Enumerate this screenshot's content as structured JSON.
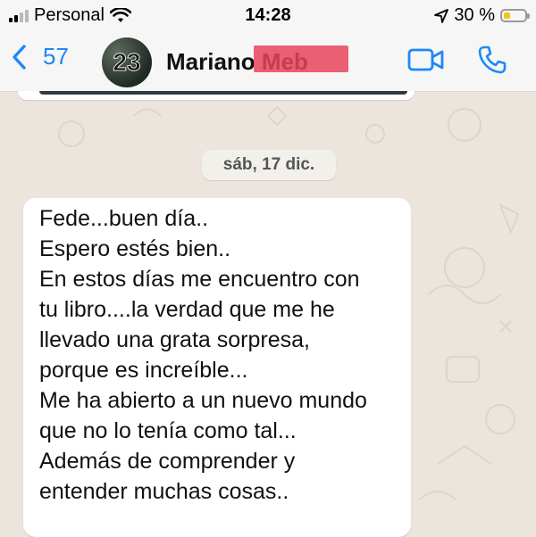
{
  "status_bar": {
    "carrier": "Personal",
    "time": "14:28",
    "battery_percent": "30 %",
    "battery_level": 0.3,
    "signal_bars": 2,
    "signal_total": 4,
    "icons": [
      "signal-icon",
      "wifi-icon",
      "location-arrow-icon",
      "battery-icon"
    ]
  },
  "header": {
    "back_count": "57",
    "contact_name": "Mariano Meb",
    "avatar_text": "23",
    "icons": [
      "chevron-left-icon",
      "video-camera-icon",
      "phone-icon"
    ],
    "accent_color": "#1e88f5"
  },
  "chat": {
    "date_separator": "sáb, 17 dic.",
    "message_lines": [
      "Fede...buen día..",
      "Espero estés bien..",
      "En estos días me encuentro con",
      "tu libro....la verdad que me he",
      "llevado una grata sorpresa,",
      "porque es increíble...",
      "Me ha abierto a un nuevo mundo",
      "que no lo tenía como tal...",
      "Además de comprender y",
      "entender muchas cosas.."
    ]
  }
}
